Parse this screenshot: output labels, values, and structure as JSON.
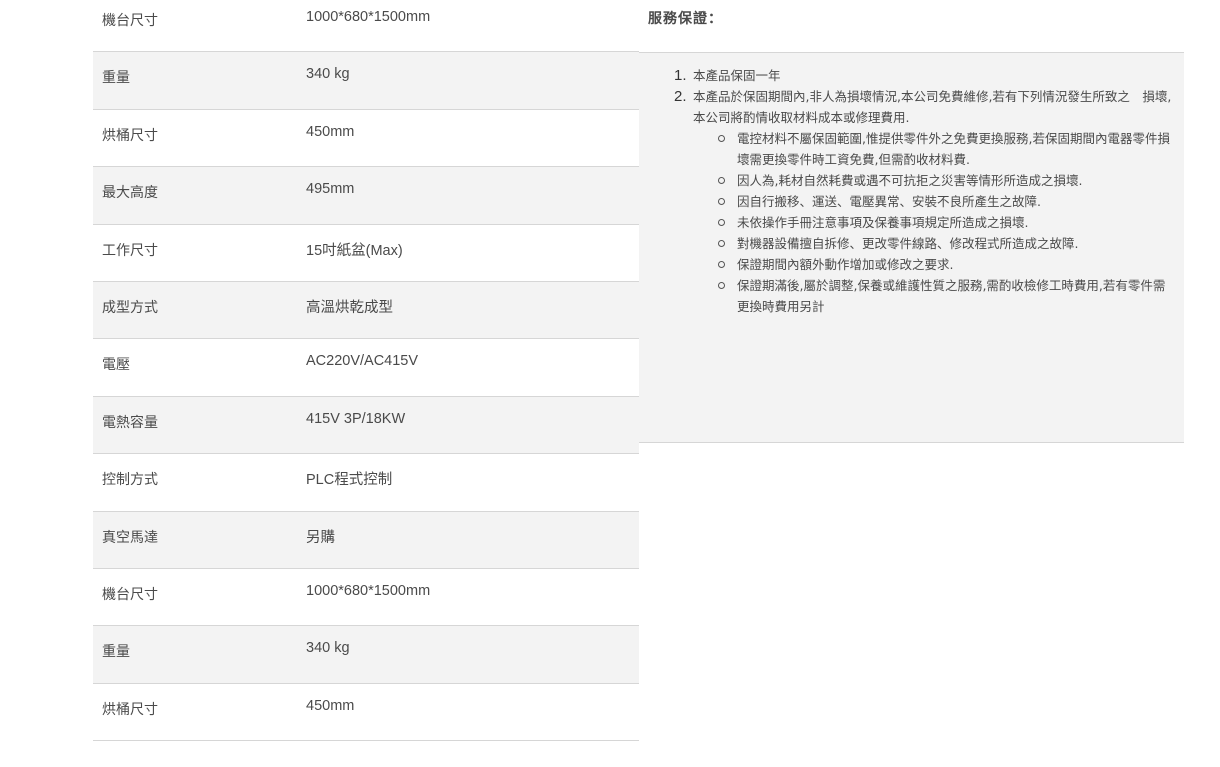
{
  "specs": [
    {
      "label": "機台尺寸",
      "value": "1000*680*1500mm"
    },
    {
      "label": "重量",
      "value": "340 kg"
    },
    {
      "label": "烘桶尺寸",
      "value": "450mm"
    },
    {
      "label": "最大高度",
      "value": "495mm"
    },
    {
      "label": "工作尺寸",
      "value": "15吋紙盆(Max)"
    },
    {
      "label": "成型方式",
      "value": "高溫烘乾成型"
    },
    {
      "label": "電壓",
      "value": "AC220V/AC415V"
    },
    {
      "label": "電熱容量",
      "value": "415V 3P/18KW"
    },
    {
      "label": "控制方式",
      "value": "PLC程式控制"
    },
    {
      "label": "真空馬達",
      "value": "另購"
    },
    {
      "label": "機台尺寸",
      "value": "1000*680*1500mm"
    },
    {
      "label": "重量",
      "value": "340 kg"
    },
    {
      "label": "烘桶尺寸",
      "value": "450mm"
    }
  ],
  "warranty": {
    "title": "服務保證：",
    "items": [
      {
        "num": "1.",
        "text": "本產品保固一年"
      },
      {
        "num": "2.",
        "text": "本產品於保固期間內,非人為損壞情況,本公司免費維修,若有下列情況發生所致之　損壞,本公司將酌情收取材料成本或修理費用."
      }
    ],
    "sub_items": [
      "電控材料不屬保固範圍,惟提供零件外之免費更換服務,若保固期間內電器零件損壞需更換零件時工資免費,但需酌收材料費.",
      "因人為,耗材自然耗費或遇不可抗拒之災害等情形所造成之損壞.",
      "因自行搬移、運送、電壓異常、安裝不良所產生之故障.",
      "未依操作手冊注意事項及保養事項規定所造成之損壞.",
      "對機器設備擅自拆修、更改零件線路、修改程式所造成之故障.",
      "保證期間內額外動作增加或修改之要求.",
      "保證期滿後,屬於調整,保養或維護性質之服務,需酌收檢修工時費用,若有零件需更換時費用另計"
    ]
  }
}
